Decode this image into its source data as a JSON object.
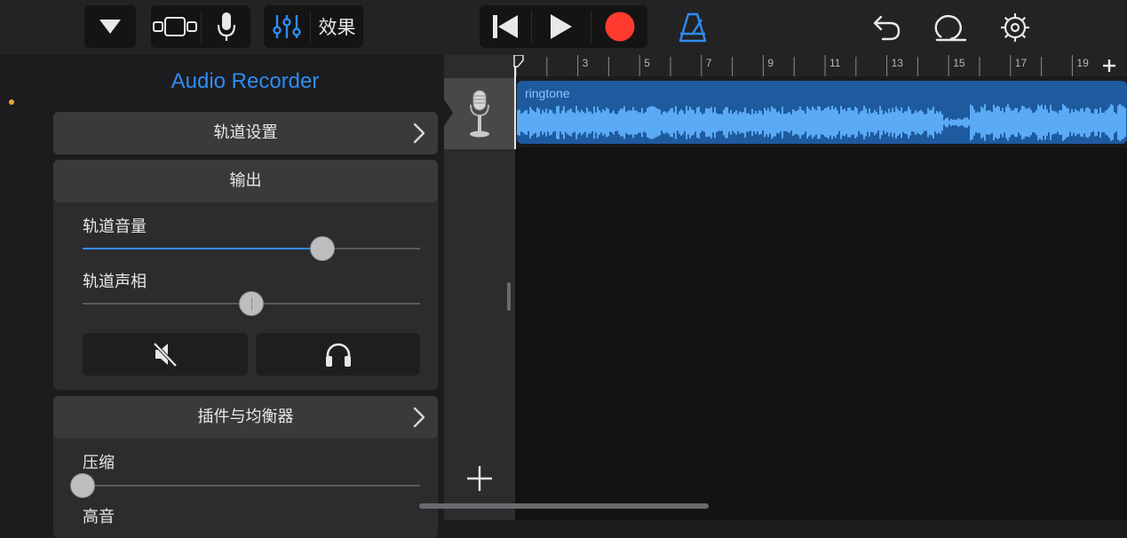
{
  "toolbar": {
    "effects_label": "效果",
    "icons": {
      "browser": "triangle-down-icon",
      "views": "tracks-view-icon",
      "mic": "microphone-icon",
      "mixer": "mixer-sliders-icon",
      "rewind": "skip-back-icon",
      "play": "play-icon",
      "record": "record-icon",
      "metronome": "metronome-icon",
      "undo": "undo-icon",
      "loop": "loop-icon",
      "settings": "gear-icon"
    },
    "colors": {
      "accent": "#2f8cf2",
      "record": "#ff3b30"
    }
  },
  "panel": {
    "title": "Audio Recorder",
    "track_settings": "轨道设置",
    "output_header": "输出",
    "volume_label": "轨道音量",
    "volume_value": 0.71,
    "pan_label": "轨道声相",
    "pan_value": 0.5,
    "mute_icon": "speaker-muted-icon",
    "solo_icon": "headphones-icon",
    "plugins_header": "插件与均衡器",
    "compression_label": "压缩",
    "compression_value": 0.0,
    "treble_label": "高音"
  },
  "track": {
    "instrument_icon": "microphone-icon",
    "add_icon": "plus-icon"
  },
  "timeline": {
    "ruler_labels": [
      "3",
      "5",
      "7",
      "9",
      "11",
      "13",
      "15",
      "17",
      "19"
    ],
    "add_section_icon": "plus-icon",
    "region": {
      "name": "ringtone",
      "color": "#1e5a9e",
      "wave_color": "#5aaaf5"
    }
  }
}
